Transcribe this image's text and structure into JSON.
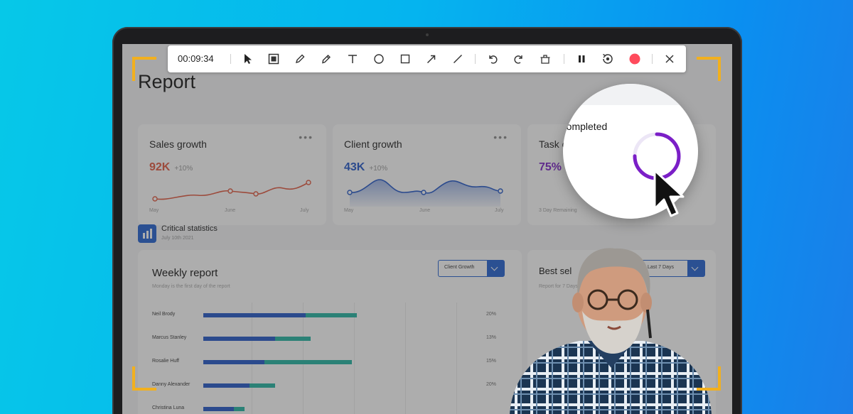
{
  "recorder": {
    "timer": "00:09:34",
    "tools": [
      "select-arrow",
      "focus-frame",
      "pen",
      "highlighter",
      "text",
      "circle",
      "rectangle",
      "arrow",
      "line",
      "undo",
      "redo",
      "clear",
      "pause",
      "restart",
      "record",
      "close"
    ]
  },
  "report": {
    "title": "Report",
    "cards": [
      {
        "title": "Sales growth",
        "value": "92K",
        "delta": "+10%",
        "color": "#e2563d",
        "axis": [
          "May",
          "June",
          "July"
        ]
      },
      {
        "title": "Client growth",
        "value": "43K",
        "delta": "+10%",
        "color": "#1f55c8",
        "axis": [
          "May",
          "June",
          "July"
        ]
      },
      {
        "title": "Task completed",
        "value": "75%",
        "note": "3 Day Remaining",
        "color": "#7b1fc7",
        "progress": 0.75
      }
    ],
    "critical": {
      "title": "Critical statistics",
      "subtitle": "July 10th 2021"
    },
    "weekly": {
      "title": "Weekly report",
      "subtitle": "Monday is the first day of the report",
      "dropdown": "Client Growth",
      "rows": [
        {
          "name": "Neil Brody",
          "pct": "20%",
          "blue": 0.2,
          "teal": 0.1
        },
        {
          "name": "Marcus Stanley",
          "pct": "13%",
          "blue": 0.14,
          "teal": 0.07
        },
        {
          "name": "Rosalie Huff",
          "pct": "15%",
          "blue": 0.12,
          "teal": 0.17
        },
        {
          "name": "Danny Alexander",
          "pct": "20%",
          "blue": 0.09,
          "teal": 0.05
        },
        {
          "name": "Christina Luna",
          "pct": "",
          "blue": 0.06,
          "teal": 0.02
        }
      ]
    },
    "best": {
      "title": "Best sel",
      "subtitle": "Report for 7 Days",
      "dropdown": "Last 7 Days"
    }
  },
  "zoom": {
    "title": "Task completed"
  }
}
